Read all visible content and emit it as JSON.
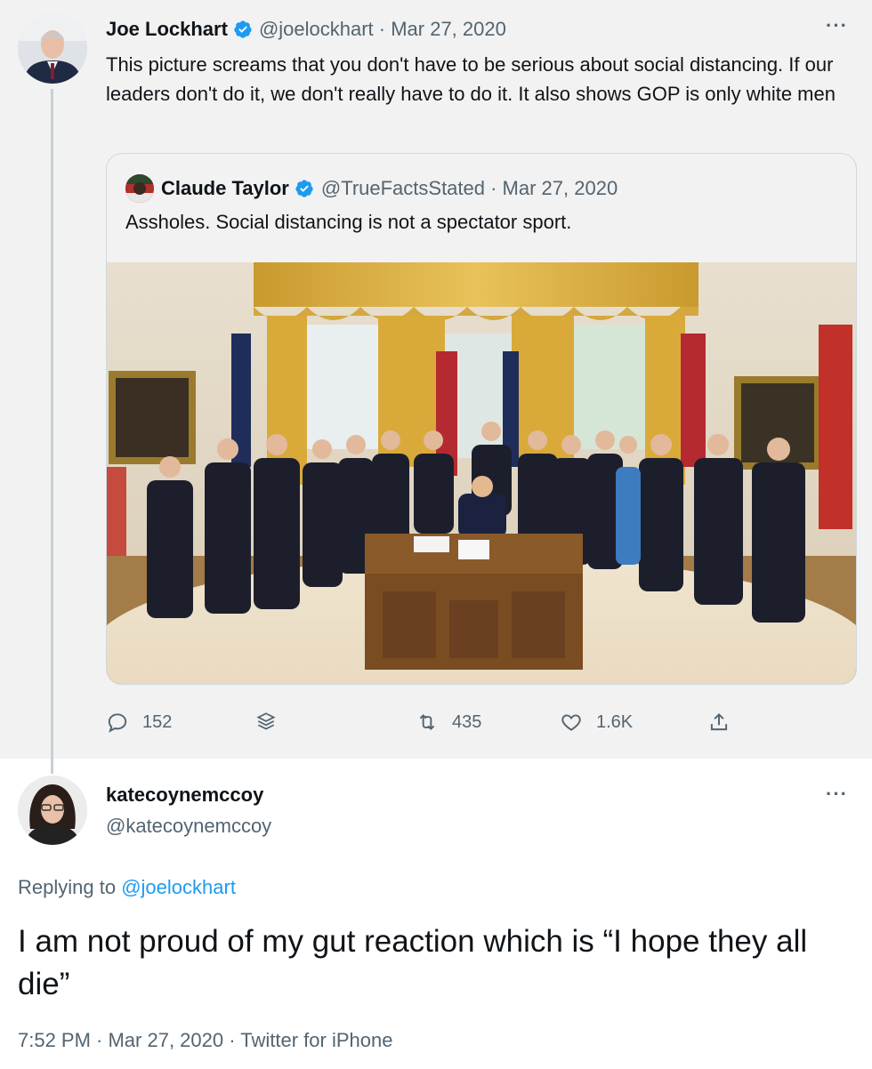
{
  "parent_tweet": {
    "display_name": "Joe Lockhart",
    "handle_and_date": "@joelockhart · Mar 27, 2020",
    "text": "This picture screams that you don't have to be serious about social distancing.  If our leaders don't do it, we don't really have to do it.  It also shows GOP is only white men",
    "more_label": "···"
  },
  "quoted_tweet": {
    "display_name": "Claude Taylor",
    "handle_and_date": "@TrueFactsStated · Mar 27, 2020",
    "text": "Assholes. Social distancing is not a spectator sport."
  },
  "actions": {
    "replies": "152",
    "retweets": "435",
    "likes": "1.6K"
  },
  "reply_tweet": {
    "display_name": "katecoynemccoy",
    "handle": "@katecoynemccoy",
    "replying_prefix": "Replying to",
    "replying_to": "@joelockhart",
    "text": "I am not proud of my gut reaction which is “I hope they all die”",
    "meta": "7:52 PM · Mar 27, 2020 · Twitter for iPhone",
    "more_label": "···"
  },
  "colors": {
    "accent": "#1d9bf0",
    "secondary_text": "#536471",
    "parent_background": "#f2f2f2"
  },
  "icons": [
    "verified-badge-icon",
    "reply-icon",
    "stack-icon",
    "retweet-icon",
    "heart-icon",
    "share-icon",
    "more-icon"
  ]
}
